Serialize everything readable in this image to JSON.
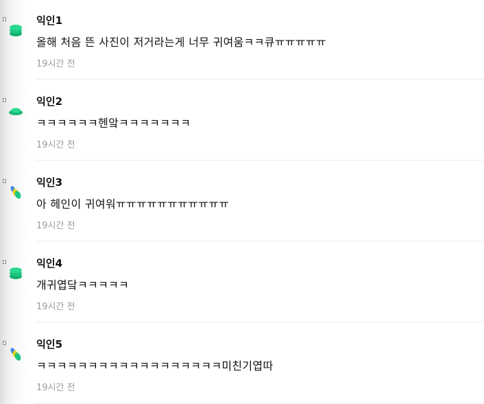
{
  "comments": [
    {
      "author": "익인1",
      "text": "올해 처음 뜬 사진이 저거라는게 너무 귀여움ㅋㅋ큐ㅠㅠㅠㅠㅠ",
      "time": "19시간 전",
      "avatar_icon": "stacked-green-discs-icon"
    },
    {
      "author": "익인2",
      "text": "ㅋㅋㅋㅋㅋㅋ헨앜ㅋㅋㅋㅋㅋㅋㅋ",
      "time": "19시간 전",
      "avatar_icon": "green-saucer-icon"
    },
    {
      "author": "익인3",
      "text": "아 헤인이 귀여워ㅠㅠㅠㅠㅠㅠㅠㅠㅠㅠㅠ",
      "time": "19시간 전",
      "avatar_icon": "green-yellow-pills-icon"
    },
    {
      "author": "익인4",
      "text": "개귀엽닼ㅋㅋㅋㅋㅋ",
      "time": "19시간 전",
      "avatar_icon": "stacked-green-discs-icon"
    },
    {
      "author": "익인5",
      "text": "ㅋㅋㅋㅋㅋㅋㅋㅋㅋㅋㅋㅋㅋㅋㅋㅋㅋㅋ미친기엽따",
      "time": "19시간 전",
      "avatar_icon": "green-yellow-pills-icon"
    }
  ],
  "colors": {
    "avatar_green": "#1fc67f",
    "avatar_yellow": "#e9d21c",
    "avatar_blue": "#3d86e6",
    "time_gray": "#9b9b9b"
  }
}
